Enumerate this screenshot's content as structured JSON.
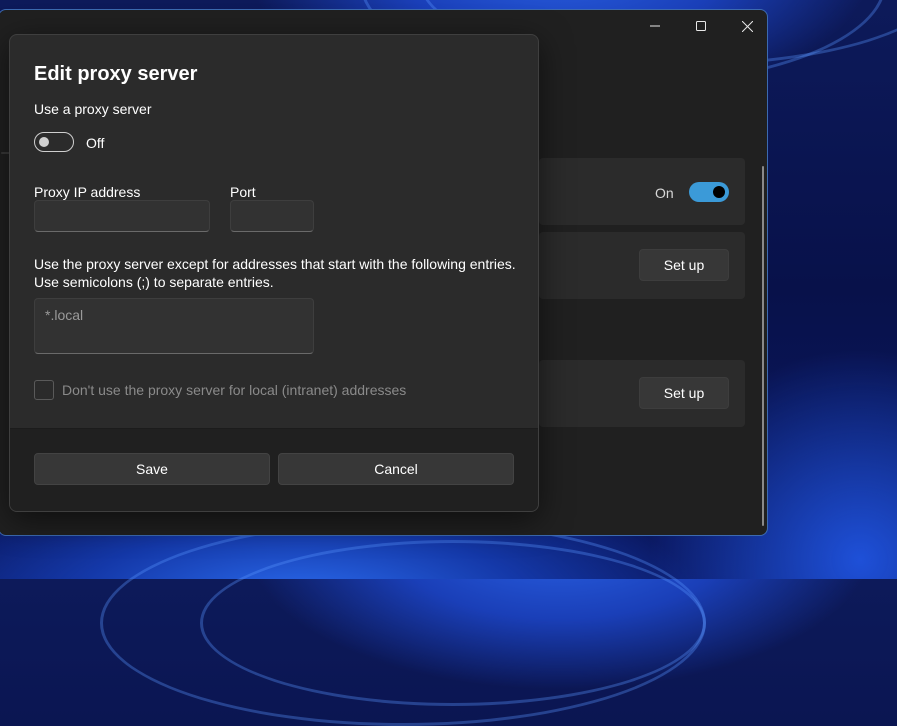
{
  "dialog": {
    "title": "Edit proxy server",
    "use_proxy_label": "Use a proxy server",
    "toggle_state_label": "Off",
    "toggle_on": false,
    "ip_label": "Proxy IP address",
    "ip_value": "",
    "port_label": "Port",
    "port_value": "",
    "exceptions_desc_line1": "Use the proxy server except for addresses that start with the following entries.",
    "exceptions_desc_line2": "Use semicolons (;) to separate entries.",
    "exceptions_placeholder": "*.local",
    "local_checkbox_label": "Don't use the proxy server for local (intranet) addresses",
    "local_checkbox_checked": false,
    "save_label": "Save",
    "cancel_label": "Cancel"
  },
  "background_window": {
    "toggle_label": "On",
    "toggle_on": true,
    "setup_button_1": "Set up",
    "setup_button_2": "Set up"
  },
  "window_controls": {
    "minimize_icon": "minimize-icon",
    "maximize_icon": "maximize-icon",
    "close_icon": "close-icon"
  },
  "colors": {
    "accent": "#3b9ad8",
    "dialog_bg": "#2b2b2b",
    "footer_bg": "#202020"
  }
}
